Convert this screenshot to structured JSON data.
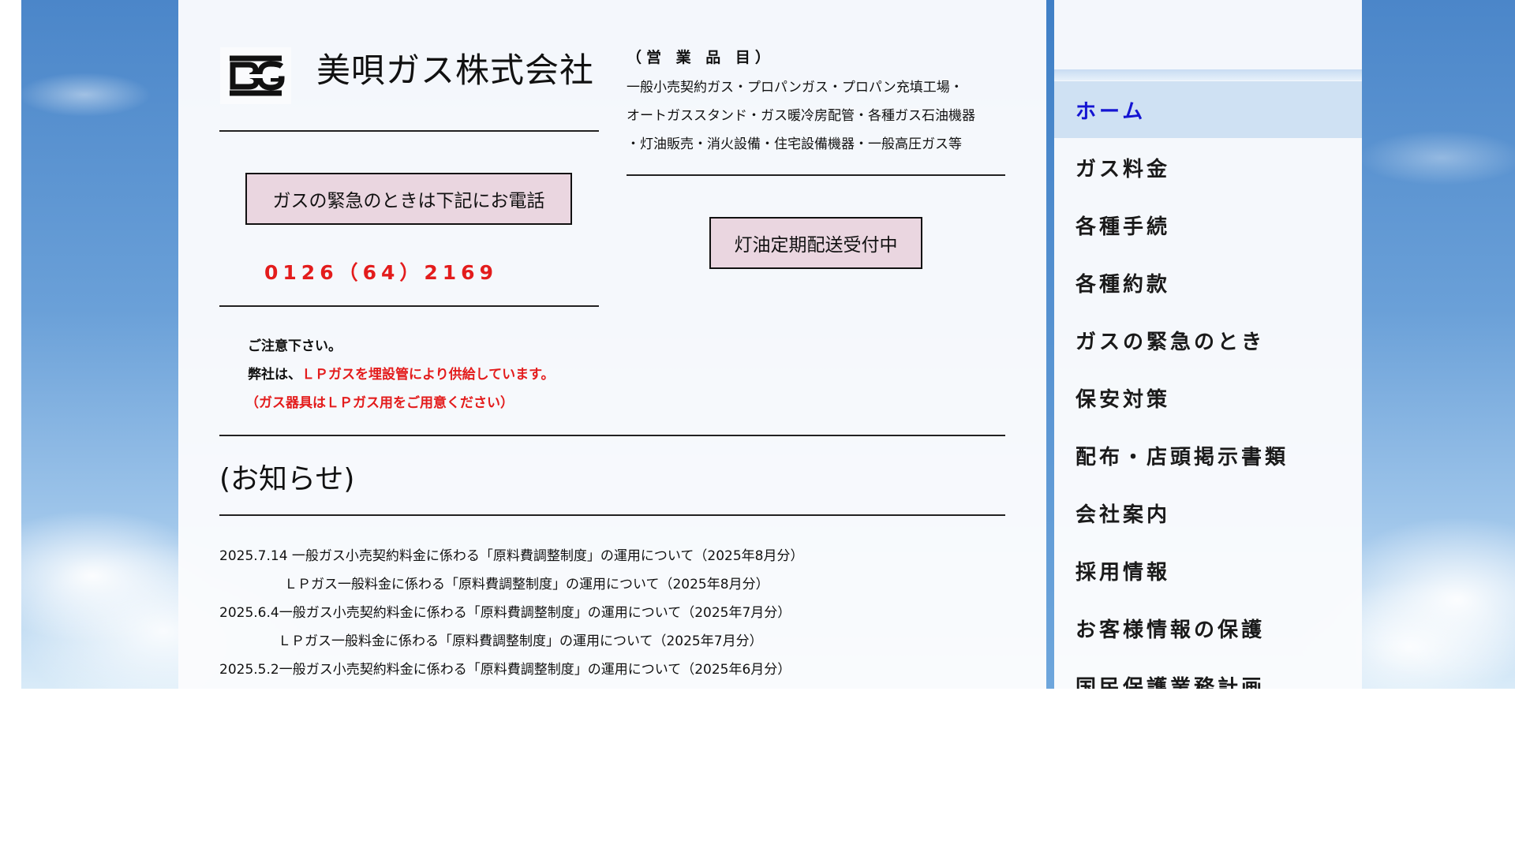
{
  "company": {
    "name": "美唄ガス株式会社",
    "logo_icon": "bg-logo-icon"
  },
  "products": {
    "heading": "（営 業 品 目）",
    "lines": [
      "一般小売契約ガス・プロパンガス・プロパン充填工場・",
      "オートガススタンド・ガス暖冷房配管・各種ガス石油機器",
      "・灯油販売・消火設備・住宅設備機器・一般高圧ガス等"
    ]
  },
  "emergency": {
    "button_label": "ガスの緊急のときは下記にお電話",
    "phone": "0126（64）2169"
  },
  "kerosene": {
    "button_label": "灯油定期配送受付中"
  },
  "notice": {
    "line1": "ご注意下さい。",
    "line2_prefix": "弊社は、",
    "line2_red": "ＬＰガスを埋設管により供給しています。",
    "line3_red": "（ガス器具はＬＰガス用をご用意ください）"
  },
  "news": {
    "heading": "(お知らせ)",
    "items": [
      "2025.7.14 一般ガス小売契約料金に係わる「原料費調整制度」の運用について（2025年8月分）",
      "ＬＰガス一般料金に係わる「原料費調整制度」の運用について（2025年8月分）",
      "2025.6.4一般ガス小売契約料金に係わる「原料費調整制度」の運用について（2025年7月分）",
      "ＬＰガス一般料金に係わる「原料費調整制度」の運用について（2025年7月分）",
      "2025.5.2一般ガス小売契約料金に係わる「原料費調整制度」の運用について（2025年6月分）"
    ]
  },
  "nav": {
    "active_color": "#1414d2",
    "active_bg": "#cfe1f3",
    "items": [
      "ホーム",
      "ガス料金",
      "各種手続",
      "各種約款",
      "ガスの緊急のとき",
      "保安対策",
      "配布・店頭掲示書類",
      "会社案内",
      "採用情報",
      "お客様情報の保護",
      "国民保護業務計画"
    ]
  }
}
